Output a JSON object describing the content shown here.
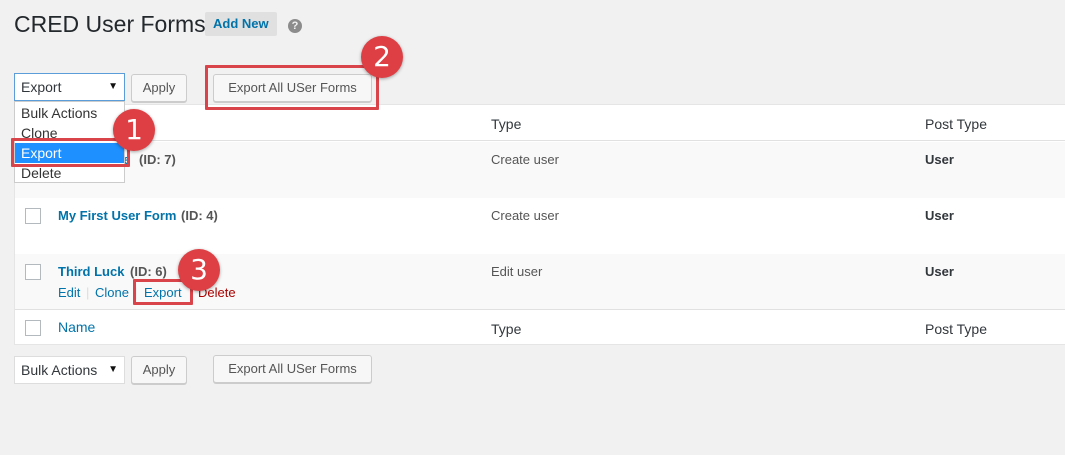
{
  "header": {
    "title": "CRED User Forms",
    "add_new": "Add New",
    "help_icon": "?"
  },
  "top_bar": {
    "select_value": "Export",
    "apply": "Apply",
    "export_all": "Export All USer Forms"
  },
  "dropdown": {
    "options": [
      "Bulk Actions",
      "Clone",
      "Export",
      "Delete"
    ],
    "selected": "Export"
  },
  "table": {
    "columns": {
      "name": "Name",
      "type": "Type",
      "post_type": "Post Type"
    },
    "rows": [
      {
        "name": "",
        "id": "(ID: 7)",
        "type": "Create user",
        "post_type": "User"
      },
      {
        "name": "My First User Form",
        "id": "(ID: 4)",
        "type": "Create user",
        "post_type": "User"
      },
      {
        "name": "Third Luck",
        "id": "(ID: 6)",
        "type": "Edit user",
        "post_type": "User",
        "actions": {
          "edit": "Edit",
          "clone": "Clone",
          "export": "Export",
          "delete": "Delete",
          "separator": "|"
        }
      }
    ],
    "partial_text_row1": "e"
  },
  "bottom_bar": {
    "select_value": "Bulk Actions",
    "apply": "Apply",
    "export_all": "Export All USer Forms"
  },
  "annotations": {
    "badge_1": "1",
    "badge_2": "2",
    "badge_3": "3",
    "highlight_color": "#d9434a"
  }
}
